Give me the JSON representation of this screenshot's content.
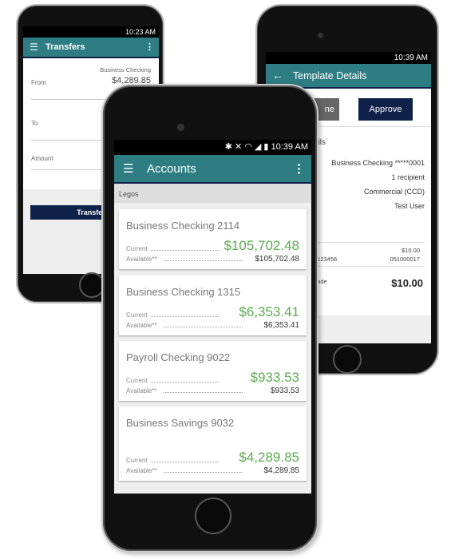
{
  "transfers": {
    "time": "10:23 AM",
    "title": "Transfers",
    "from_label": "From",
    "from_account": "Business Checking",
    "from_amount": "$4,289.85",
    "to_label": "To",
    "amount_label": "Amount",
    "button": "Transfer"
  },
  "template": {
    "time": "10:39 AM",
    "title": "Template Details",
    "decline_fragment": "ne",
    "approve": "Approve",
    "section_fragment": "ails",
    "rows": [
      "Business Checking *****0001",
      "1 recipient",
      "Commercial (CCD)",
      "Test User"
    ],
    "recipient_fragment": "g123456",
    "amount_small": "$10.00",
    "routing": "051000017",
    "total_fragment": "nade",
    "total": "$10.00"
  },
  "accounts": {
    "time": "10:39 AM",
    "title": "Accounts",
    "section": "Legos",
    "current_label": "Current",
    "available_label": "Available**",
    "items": [
      {
        "name": "Business Checking 2114",
        "current": "$105,702.48",
        "available": "$105,702.48"
      },
      {
        "name": "Business Checking 1315",
        "current": "$6,353.41",
        "available": "$6,353.41"
      },
      {
        "name": "Payroll Checking 9022",
        "current": "$933.53",
        "available": "$933.53"
      },
      {
        "name": "Business Savings 9032",
        "current": "$4,289.85",
        "available": "$4,289.85"
      }
    ]
  },
  "colors": {
    "header": "#2e7d82",
    "button": "#0d2149",
    "balance": "#5cab4f"
  }
}
